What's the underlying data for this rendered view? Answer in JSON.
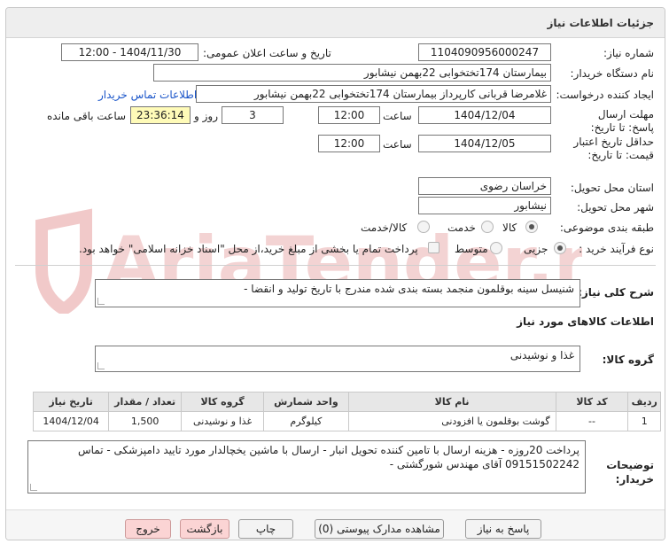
{
  "header": {
    "title": "جزئیات اطلاعات نیاز"
  },
  "form": {
    "need_number_label": "شماره نیاز:",
    "need_number": "1104090956000247",
    "announce_label": "تاریخ و ساعت اعلان عمومی:",
    "announce_value": "1404/11/30 - 12:00",
    "buyer_org_label": "نام دستگاه خریدار:",
    "buyer_org": "بیمارستان 174تختخوابی 22بهمن نیشابور",
    "creator_label": "ایجاد کننده درخواست:",
    "creator": "غلامرضا قربانی کارپرداز بیمارستان 174تختخوابی 22بهمن نیشابور",
    "contact_link": "اطلاعات تماس خریدار",
    "reply_deadline_label": "مهلت ارسال پاسخ: تا تاریخ:",
    "reply_date": "1404/12/04",
    "time_word": "ساعت",
    "reply_time": "12:00",
    "days_remaining": "3",
    "day_and_label": "روز و",
    "countdown": "23:36:14",
    "remaining_label": "ساعت باقی مانده",
    "price_validity_label": "حداقل تاریخ اعتبار قیمت: تا تاریخ:",
    "price_date": "1404/12/05",
    "price_time": "12:00",
    "province_label": "استان محل تحویل:",
    "province": "خراسان رضوی",
    "city_label": "شهر محل تحویل:",
    "city": "نیشابور",
    "category_label": "طبقه بندی موضوعی:",
    "category_options": [
      "کالا",
      "خدمت",
      "کالا/خدمت"
    ],
    "category_selected": "کالا",
    "process_label": "نوع فرآیند خرید :",
    "process_options": [
      "جزیی",
      "متوسط"
    ],
    "process_selected": "جزیی",
    "payment_note": "پرداخت تمام یا بخشی از مبلغ خرید،از محل \"اسناد خزانه اسلامی\" خواهد بود."
  },
  "summary": {
    "label": "شرح کلی نیاز:",
    "value": "شنیسل سینه بوقلمون منجمد بسته بندی شده مندرج با تاریخ تولید و انقضا -"
  },
  "goods": {
    "section_title": "اطلاعات کالاهای مورد نیاز",
    "group_label": "گروه کالا:",
    "group_value": "غذا و نوشیدنی",
    "columns": [
      "ردیف",
      "کد کالا",
      "نام کالا",
      "واحد شمارش",
      "گروه کالا",
      "تعداد / مقدار",
      "تاریخ نیاز"
    ],
    "rows": [
      [
        "1",
        "--",
        "گوشت بوقلمون یا افزودنی",
        "کیلوگرم",
        "غذا و نوشیدنی",
        "1,500",
        "1404/12/04"
      ]
    ]
  },
  "notes": {
    "label": "توضیحات خریدار:",
    "value": "پرداخت 20روزه - هزینه ارسال با تامین کننده تحویل انبار - ارسال با ماشین یخچالدار مورد تایید دامپزشکی - تماس 09151502242 آقای مهندس شورگشتی -"
  },
  "buttons": {
    "reply": "پاسخ به نیاز",
    "view_docs": "مشاهده مدارک پیوستی (0)",
    "print": "چاپ",
    "back": "بازگشت",
    "exit": "خروج"
  },
  "watermark": {
    "brand": "AriaTender.neT"
  },
  "colors": {
    "link": "#1a55c9",
    "highlight": "#fffbb8",
    "pink_button": "#fbd4d4",
    "watermark": "#f1c9c9"
  }
}
